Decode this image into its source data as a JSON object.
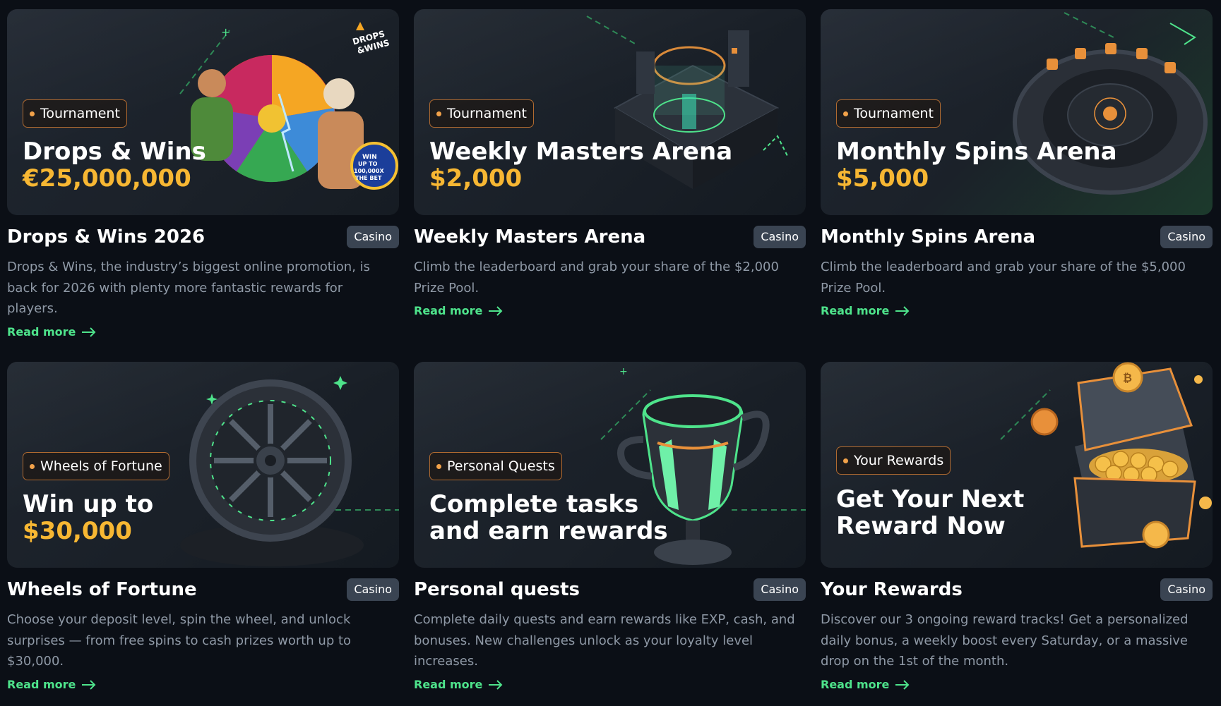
{
  "cards": [
    {
      "badge": "Tournament",
      "headline_line1": "Drops & Wins",
      "headline_line2": "€25,000,000",
      "title": "Drops & Wins 2026",
      "tag": "Casino",
      "description": "Drops & Wins, the industry’s biggest online promotion, is back for 2026 with plenty more fantastic rewards for players.",
      "link": "Read more",
      "logo_text": "DROPS & WINS",
      "sticker_text": "WIN UP TO 100,000X THE BET"
    },
    {
      "badge": "Tournament",
      "headline_line1": "Weekly Masters Arena",
      "headline_line2": "$2,000",
      "title": "Weekly Masters Arena",
      "tag": "Casino",
      "description": "Climb the leaderboard and grab your share of the $2,000 Prize Pool.",
      "link": "Read more"
    },
    {
      "badge": "Tournament",
      "headline_line1": "Monthly Spins Arena",
      "headline_line2": "$5,000",
      "title": "Monthly Spins Arena",
      "tag": "Casino",
      "description": "Climb the leaderboard and grab your share of the $5,000 Prize Pool.",
      "link": "Read more"
    },
    {
      "badge": "Wheels of Fortune",
      "headline_line1": "Win up to",
      "headline_line2": "$30,000",
      "title": "Wheels of Fortune",
      "tag": "Casino",
      "description": "Choose your deposit level, spin the wheel, and unlock surprises — from free spins to cash prizes worth up to $30,000.",
      "link": "Read more"
    },
    {
      "badge": "Personal Quests",
      "headline_line1": "Complete tasks",
      "headline_line2": "and earn rewards",
      "title": "Personal quests",
      "tag": "Casino",
      "description": "Complete daily quests and earn rewards like EXP, cash, and bonuses. New challenges unlock as your loyalty level increases.",
      "link": "Read more"
    },
    {
      "badge": "Your Rewards",
      "headline_line1": "Get Your Next",
      "headline_line2": "Reward Now",
      "title": "Your Rewards",
      "tag": "Casino",
      "description": "Discover our 3 ongoing reward tracks! Get a personalized daily bonus, a weekly boost every Saturday, or a massive drop on the 1st of the month.",
      "link": "Read more"
    }
  ],
  "colors": {
    "background": "#0b0f16",
    "accent_gold": "#f7b733",
    "accent_green": "#4ee38b",
    "badge_border": "#b06a30"
  },
  "icons": [
    "arrow-right-icon",
    "badge-dot-icon"
  ]
}
